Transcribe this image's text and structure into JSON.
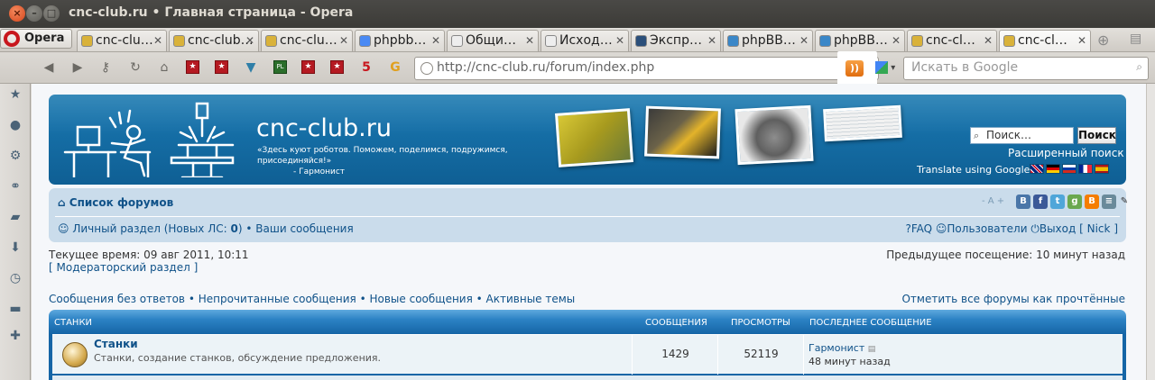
{
  "window": {
    "title": "cnc-club.ru • Главная страница - Opera"
  },
  "browser": {
    "menu_label": "Opera",
    "tabs": [
      {
        "label": "cnc-clu…",
        "icon": "cnc-favicon"
      },
      {
        "label": "cnc-club…",
        "icon": "cnc-favicon"
      },
      {
        "label": "cnc-clu…",
        "icon": "cnc-favicon"
      },
      {
        "label": "phpbb…",
        "icon": "google-favicon"
      },
      {
        "label": "Общи…",
        "icon": "document-favicon"
      },
      {
        "label": "Исход…",
        "icon": "document-favicon"
      },
      {
        "label": "Экспр…",
        "icon": "speed-dial-favicon"
      },
      {
        "label": "phpBB…",
        "icon": "phpbb-favicon"
      },
      {
        "label": "phpBB…",
        "icon": "phpbb-favicon"
      },
      {
        "label": "cnc-cl…",
        "icon": "cnc-favicon"
      },
      {
        "label": "cnc-cl…",
        "icon": "cnc-favicon",
        "active": true
      }
    ],
    "bookmarks": [
      "PL",
      "5",
      "G"
    ],
    "address": "http://cnc-club.ru/forum/index.php",
    "search_placeholder": "Искать в Google",
    "accent_rss": "#f08a24"
  },
  "header": {
    "site_title": "cnc-club.ru",
    "site_desc": "«Здесь куют роботов. Поможем, поделимся, подружимся, присоединяйся!»",
    "site_desc_author": "- Гармонист",
    "search_placeholder": "Поиск…",
    "search_button": "Поиск",
    "advanced_search": "Расширенный поиск",
    "translate_label": "Translate using Google:"
  },
  "nav": {
    "home_label": "Список форумов",
    "font_size_label": "- A +",
    "personal_label": "Личный раздел (Новых ЛС:",
    "personal_count": "0",
    "personal_close": ")",
    "your_posts": "Ваши сообщения",
    "faq": "FAQ",
    "users": "Пользователи",
    "logout_prefix": "Выход [",
    "logout_user": "Nick",
    "logout_suffix": "]"
  },
  "info": {
    "current_time": "Текущее время: 09 авг 2011, 10:11",
    "moderator": "[ Модераторский раздел ]",
    "prev_visit": "Предыдущее посещение: 10 минут назад",
    "link_unanswered": "Сообщения без ответов",
    "link_unread": "Непрочитанные сообщения",
    "link_new": "Новые сообщения",
    "link_active": "Активные темы",
    "mark_read": "Отметить все форумы как прочтённые"
  },
  "forum": {
    "category": "Станки",
    "col_posts": "Сообщения",
    "col_views": "Просмотры",
    "col_last": "Последнее сообщение",
    "rows": [
      {
        "title": "Станки",
        "desc": "Станки, создание станков, обсуждение предложения.",
        "posts": "1429",
        "views": "52119",
        "last_user": "Гармонист",
        "last_time": "48 минут назад"
      }
    ]
  }
}
